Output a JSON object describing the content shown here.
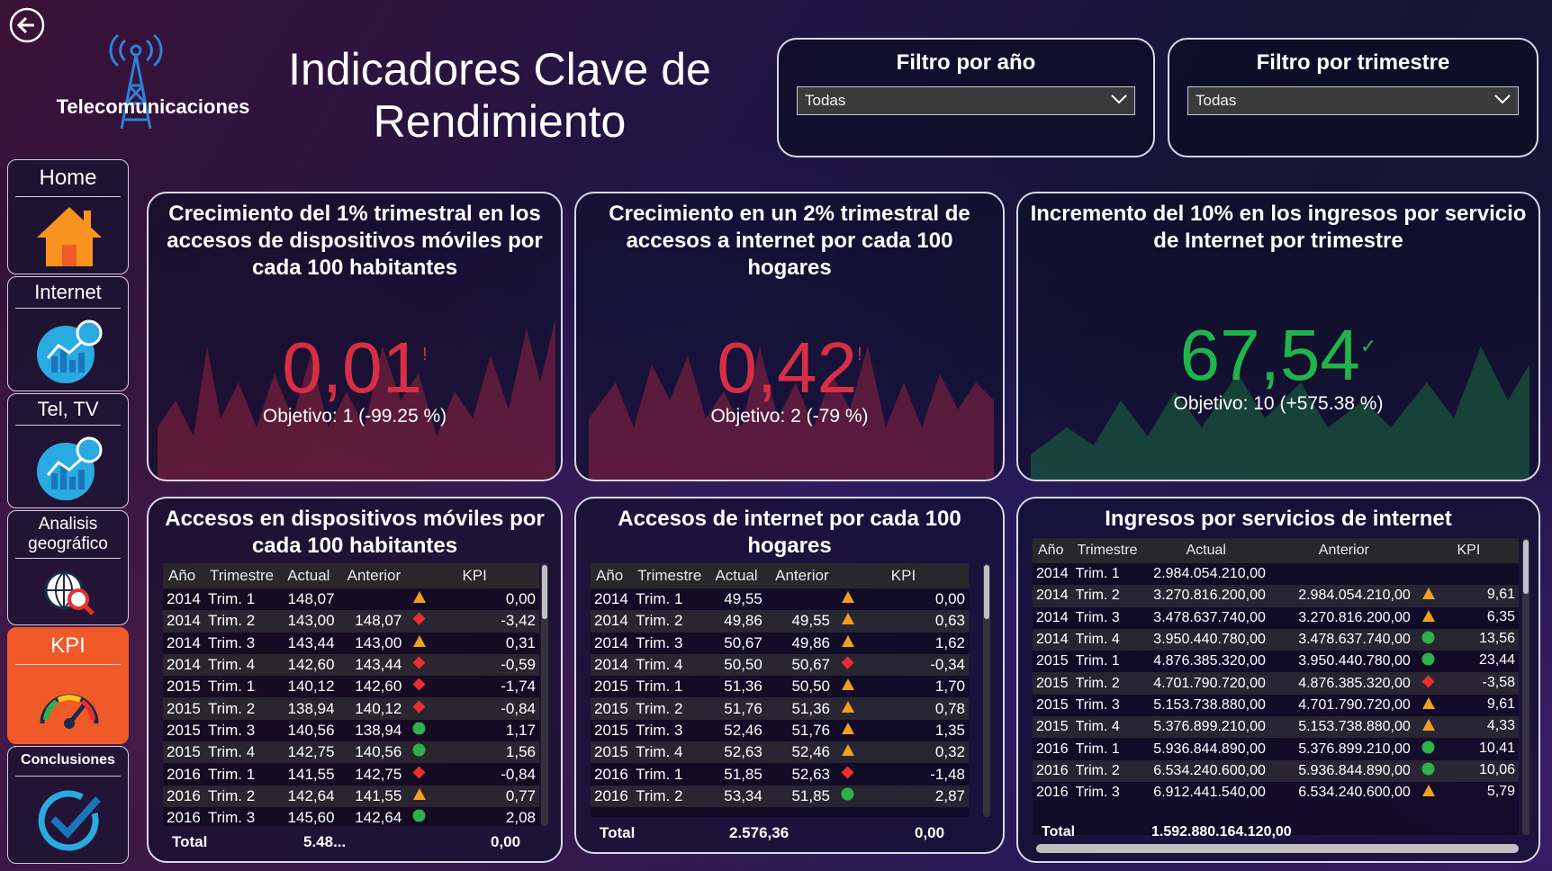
{
  "header": {
    "brand": "Telecomunicaciones",
    "title": "Indicadores Clave de Rendimiento"
  },
  "filters": {
    "year": {
      "label": "Filtro por año",
      "value": "Todas"
    },
    "quarter": {
      "label": "Filtro por trimestre",
      "value": "Todas"
    }
  },
  "nav": [
    {
      "label": "Home",
      "icon": "home-icon"
    },
    {
      "label": "Internet",
      "icon": "chart-globe-icon"
    },
    {
      "label": "Tel, TV",
      "icon": "chart-globe-icon"
    },
    {
      "label": "Analisis geográfico",
      "icon": "globe-search-icon"
    },
    {
      "label": "KPI",
      "icon": "gauge-icon",
      "active": true
    },
    {
      "label": "Conclusiones",
      "icon": "check-circle-icon"
    }
  ],
  "kpis": [
    {
      "title": "Crecimiento del 1% trimestral en los accesos de dispositivos móviles por cada 100 habitantes",
      "value": "0,01",
      "status": "!",
      "target": "Objetivo: 1 (-99.25 %)",
      "color": "#d62f45"
    },
    {
      "title": "Crecimiento en un 2% trimestral de accesos a internet por cada 100 hogares",
      "value": "0,42",
      "status": "!",
      "target": "Objetivo: 2 (-79 %)",
      "color": "#d62f45"
    },
    {
      "title": "Incremento del 10% en los ingresos por servicio de Internet por trimestre",
      "value": "67,54",
      "status": "✓",
      "target": "Objetivo: 10 (+575.38 %)",
      "color": "#1fb54a"
    }
  ],
  "table1": {
    "title": "Accesos en dispositivos móviles por cada 100 habitantes",
    "headers": [
      "Año",
      "Trimestre",
      "Actual",
      "Anterior",
      "KPI"
    ],
    "rows": [
      [
        "2014",
        "Trim. 1",
        "148,07",
        "",
        "up",
        "0,00"
      ],
      [
        "2014",
        "Trim. 2",
        "143,00",
        "148,07",
        "down",
        "-3,42"
      ],
      [
        "2014",
        "Trim. 3",
        "143,44",
        "143,00",
        "up",
        "0,31"
      ],
      [
        "2014",
        "Trim. 4",
        "142,60",
        "143,44",
        "down",
        "-0,59"
      ],
      [
        "2015",
        "Trim. 1",
        "140,12",
        "142,60",
        "down",
        "-1,74"
      ],
      [
        "2015",
        "Trim. 2",
        "138,94",
        "140,12",
        "down",
        "-0,84"
      ],
      [
        "2015",
        "Trim. 3",
        "140,56",
        "138,94",
        "good",
        "1,17"
      ],
      [
        "2015",
        "Trim. 4",
        "142,75",
        "140,56",
        "good",
        "1,56"
      ],
      [
        "2016",
        "Trim. 1",
        "141,55",
        "142,75",
        "down",
        "-0,84"
      ],
      [
        "2016",
        "Trim. 2",
        "142,64",
        "141,55",
        "up",
        "0,77"
      ],
      [
        "2016",
        "Trim. 3",
        "145,60",
        "142,64",
        "good",
        "2,08"
      ]
    ],
    "total_label": "Total",
    "total_actual": "5.48...",
    "total_kpi": "0,00"
  },
  "table2": {
    "title": "Accesos de internet por cada 100 hogares",
    "headers": [
      "Año",
      "Trimestre",
      "Actual",
      "Anterior",
      "KPI"
    ],
    "rows": [
      [
        "2014",
        "Trim. 1",
        "49,55",
        "",
        "up",
        "0,00"
      ],
      [
        "2014",
        "Trim. 2",
        "49,86",
        "49,55",
        "up",
        "0,63"
      ],
      [
        "2014",
        "Trim. 3",
        "50,67",
        "49,86",
        "up",
        "1,62"
      ],
      [
        "2014",
        "Trim. 4",
        "50,50",
        "50,67",
        "down",
        "-0,34"
      ],
      [
        "2015",
        "Trim. 1",
        "51,36",
        "50,50",
        "up",
        "1,70"
      ],
      [
        "2015",
        "Trim. 2",
        "51,76",
        "51,36",
        "up",
        "0,78"
      ],
      [
        "2015",
        "Trim. 3",
        "52,46",
        "51,76",
        "up",
        "1,35"
      ],
      [
        "2015",
        "Trim. 4",
        "52,63",
        "52,46",
        "up",
        "0,32"
      ],
      [
        "2016",
        "Trim. 1",
        "51,85",
        "52,63",
        "down",
        "-1,48"
      ],
      [
        "2016",
        "Trim. 2",
        "53,34",
        "51,85",
        "good",
        "2,87"
      ]
    ],
    "total_label": "Total",
    "total_actual": "2.576,36",
    "total_kpi": "0,00"
  },
  "table3": {
    "title": "Ingresos por servicios de internet",
    "headers": [
      "Año",
      "Trimestre",
      "Actual",
      "Anterior",
      "KPI"
    ],
    "rows": [
      [
        "2014",
        "Trim. 1",
        "2.984.054.210,00",
        "",
        "",
        ""
      ],
      [
        "2014",
        "Trim. 2",
        "3.270.816.200,00",
        "2.984.054.210,00",
        "up",
        "9,61"
      ],
      [
        "2014",
        "Trim. 3",
        "3.478.637.740,00",
        "3.270.816.200,00",
        "up",
        "6,35"
      ],
      [
        "2014",
        "Trim. 4",
        "3.950.440.780,00",
        "3.478.637.740,00",
        "good",
        "13,56"
      ],
      [
        "2015",
        "Trim. 1",
        "4.876.385.320,00",
        "3.950.440.780,00",
        "good",
        "23,44"
      ],
      [
        "2015",
        "Trim. 2",
        "4.701.790.720,00",
        "4.876.385.320,00",
        "down",
        "-3,58"
      ],
      [
        "2015",
        "Trim. 3",
        "5.153.738.880,00",
        "4.701.790.720,00",
        "up",
        "9,61"
      ],
      [
        "2015",
        "Trim. 4",
        "5.376.899.210,00",
        "5.153.738.880,00",
        "up",
        "4,33"
      ],
      [
        "2016",
        "Trim. 1",
        "5.936.844.890,00",
        "5.376.899.210,00",
        "good",
        "10,41"
      ],
      [
        "2016",
        "Trim. 2",
        "6.534.240.600,00",
        "5.936.844.890,00",
        "good",
        "10,06"
      ],
      [
        "2016",
        "Trim. 3",
        "6.912.441.540,00",
        "6.534.240.600,00",
        "up",
        "5,79"
      ]
    ],
    "total_label": "Total",
    "total_actual": "1.592.880.164.120,00"
  },
  "colors": {
    "up": "#f0a020",
    "down": "#e83030",
    "good": "#2eb04a",
    "orange_nav": "#f05a28"
  }
}
